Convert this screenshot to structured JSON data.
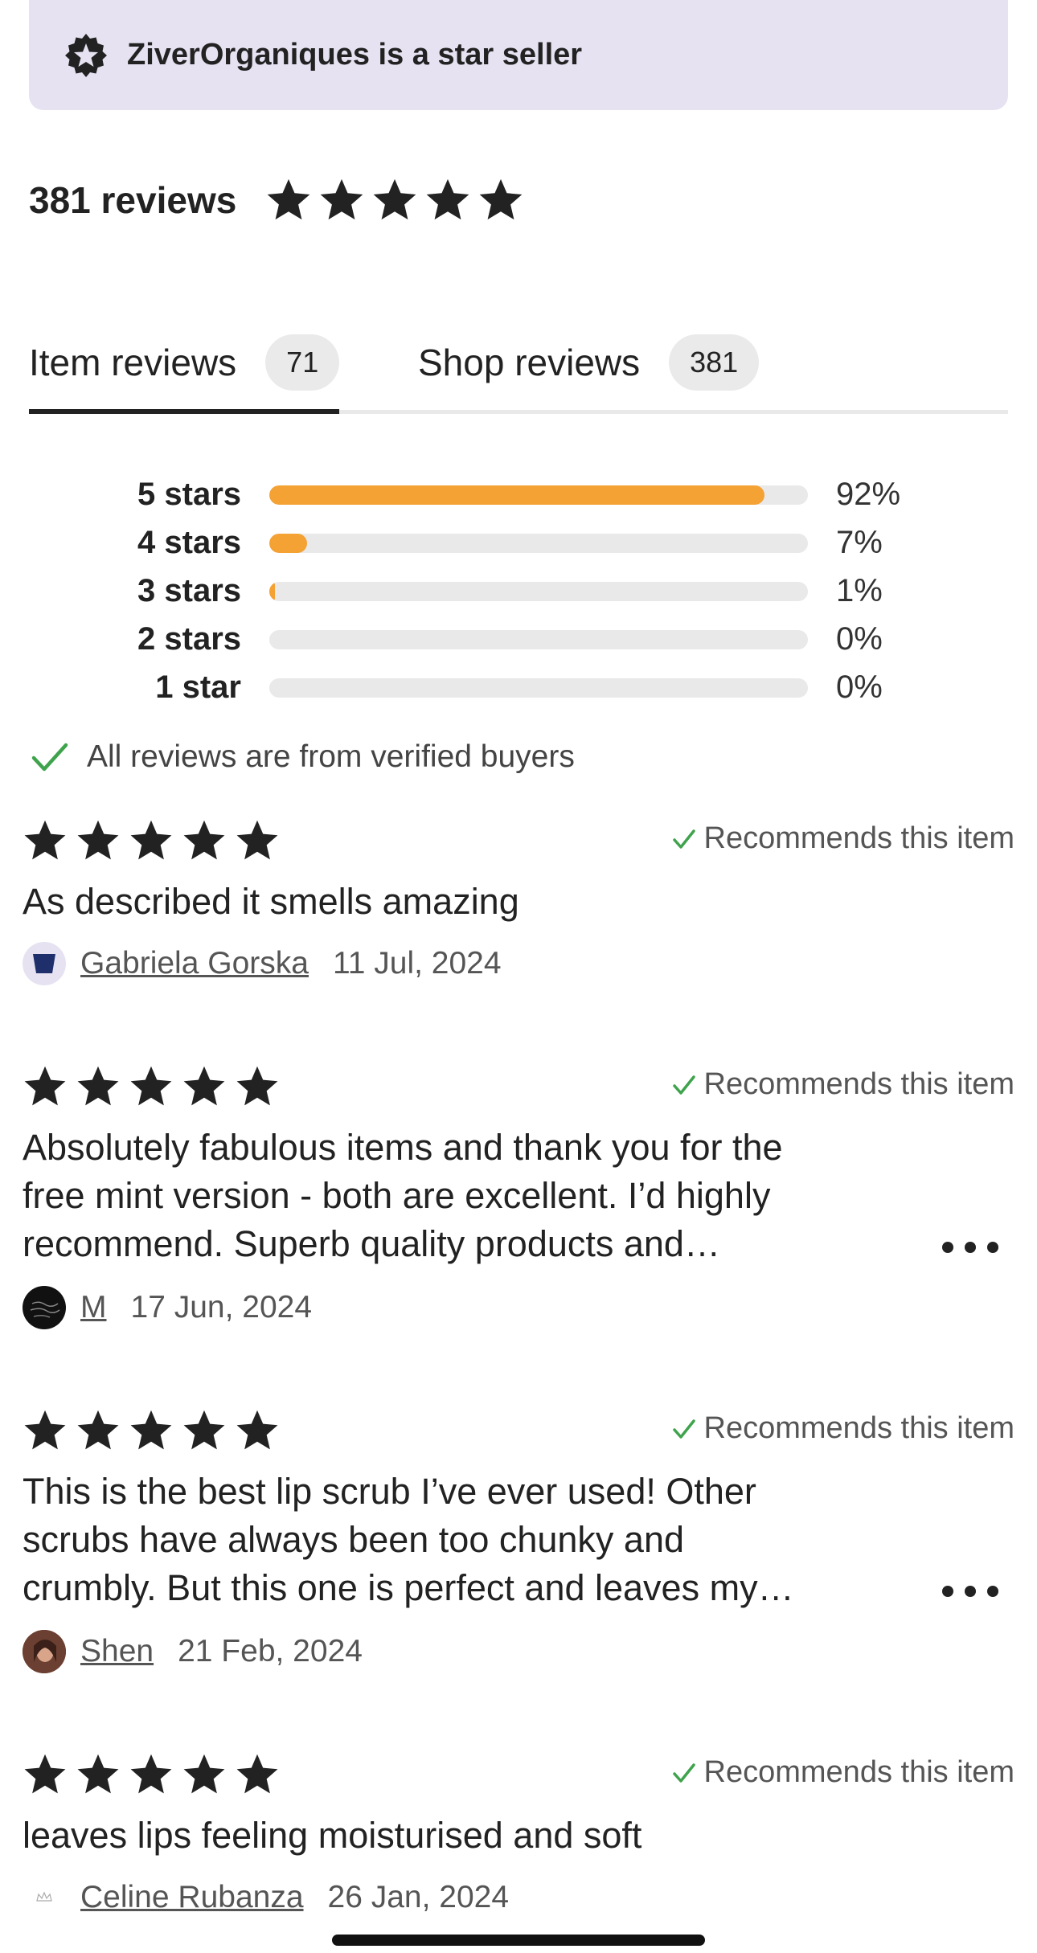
{
  "star_seller": {
    "text": "ZiverOrganiques is a star seller"
  },
  "summary": {
    "count_label": "381 reviews",
    "rating_stars": 5
  },
  "tabs": [
    {
      "label": "Item reviews",
      "count": "71",
      "active": true
    },
    {
      "label": "Shop reviews",
      "count": "381",
      "active": false
    }
  ],
  "breakdown": [
    {
      "label": "5 stars",
      "percent": 92,
      "percent_label": "92%"
    },
    {
      "label": "4 stars",
      "percent": 7,
      "percent_label": "7%"
    },
    {
      "label": "3 stars",
      "percent": 1,
      "percent_label": "1%"
    },
    {
      "label": "2 stars",
      "percent": 0,
      "percent_label": "0%"
    },
    {
      "label": "1 star",
      "percent": 0,
      "percent_label": "0%"
    }
  ],
  "verified_text": "All reviews are from verified buyers",
  "recommend_label": "Recommends this item",
  "reviews": [
    {
      "stars": 5,
      "text_lines": [
        "As described it smells amazing"
      ],
      "truncated": false,
      "reviewer": "Gabriela Gorska",
      "date": "11 Jul, 2024",
      "avatar": "gabriela-avatar"
    },
    {
      "stars": 5,
      "text_lines": [
        "Absolutely fabulous items and thank you for the",
        "free mint version - both are excellent. I’d highly",
        "recommend. Superb quality products and…"
      ],
      "truncated": true,
      "reviewer": "M",
      "date": "17 Jun, 2024",
      "avatar": "m-avatar"
    },
    {
      "stars": 5,
      "text_lines": [
        "This is the best lip scrub I’ve ever used! Other",
        "scrubs have always been too chunky and",
        "crumbly. But this one is perfect and leaves my…"
      ],
      "truncated": true,
      "reviewer": "Shen",
      "date": "21 Feb, 2024",
      "avatar": "shen-avatar"
    },
    {
      "stars": 5,
      "text_lines": [
        "leaves lips feeling moisturised and soft"
      ],
      "truncated": false,
      "reviewer": "Celine Rubanza",
      "date": "26 Jan, 2024",
      "avatar": "celine-avatar"
    }
  ],
  "colors": {
    "banner_bg": "#e6e2f1",
    "bar_fill": "#f4a234",
    "bar_track": "#e9e9e9",
    "check_green": "#3fa34d",
    "text": "#222222"
  }
}
